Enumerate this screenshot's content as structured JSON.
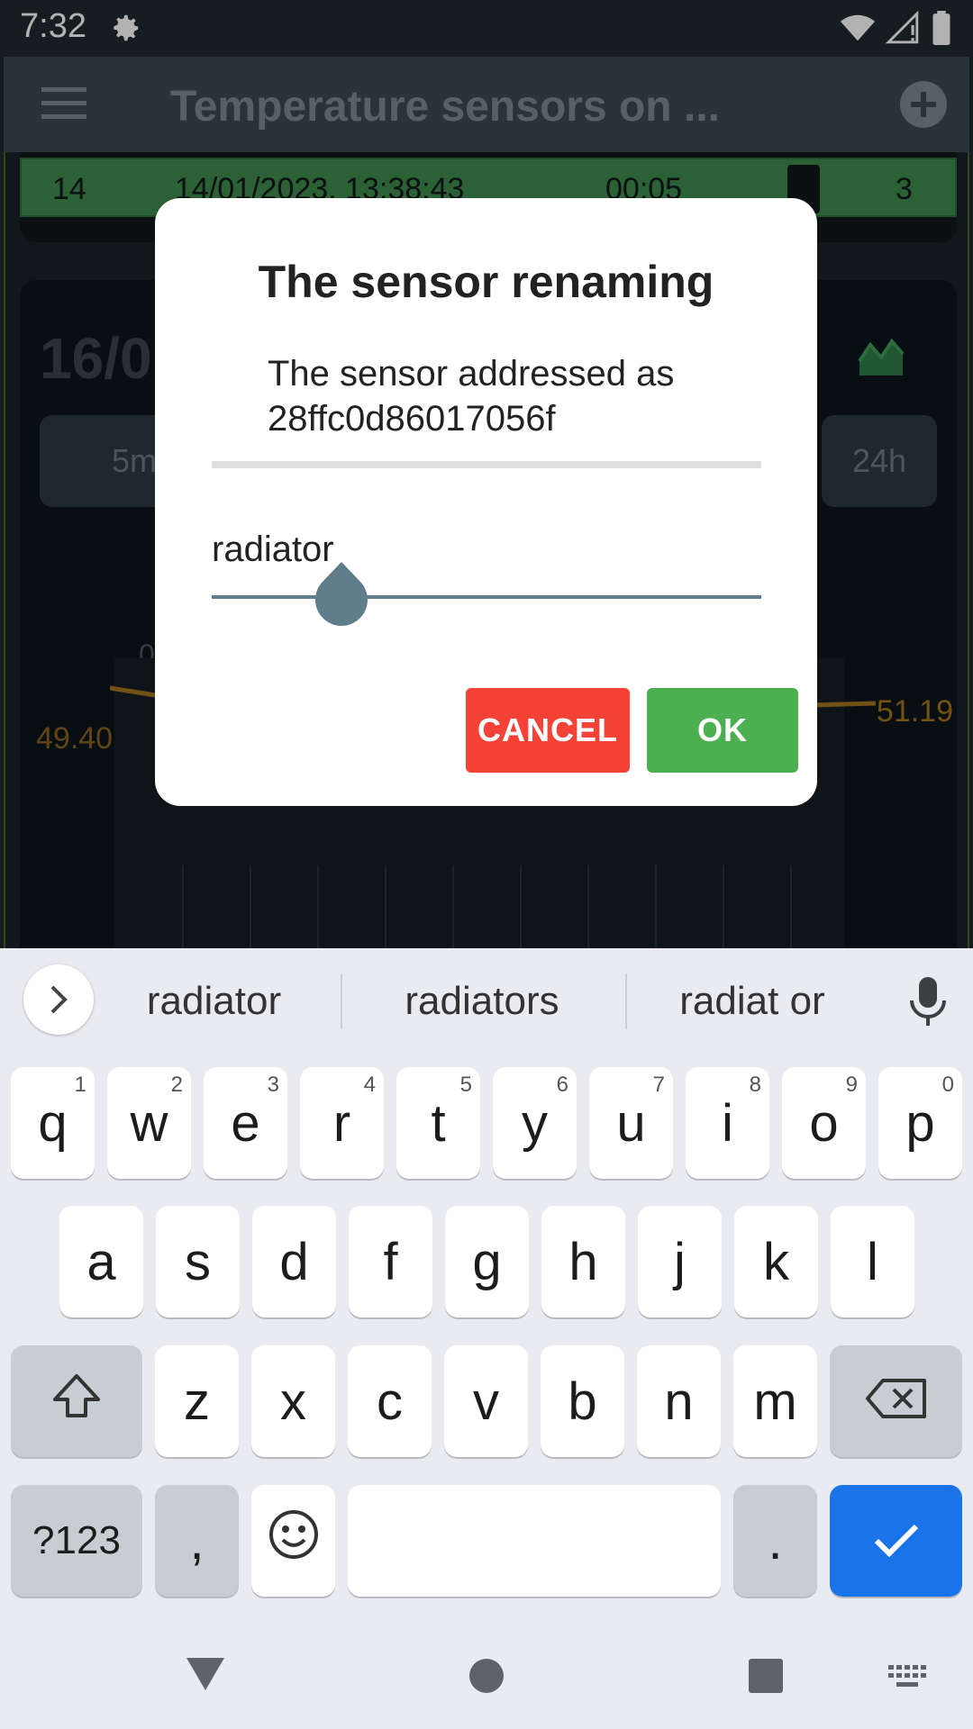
{
  "status_bar": {
    "time": "7:32"
  },
  "app_bar": {
    "title": "Temperature sensors on ..."
  },
  "background": {
    "row": {
      "index": "14",
      "datetime": "14/01/2023, 13:38:43",
      "duration": "00:05",
      "count": "3"
    },
    "date_partial": "16/0",
    "chips": [
      "5m",
      "24h"
    ],
    "tick_partial": "0",
    "value_left": "49.40",
    "value_right": "51.19"
  },
  "dialog": {
    "title": "The sensor renaming",
    "description": "The sensor addressed as 28ffc0d86017056f",
    "input_value": "radiator",
    "cancel_label": "CANCEL",
    "ok_label": "OK"
  },
  "keyboard": {
    "suggestions": [
      "radiator",
      "radiators",
      "radiat or"
    ],
    "rows": [
      [
        {
          "k": "q",
          "h": "1"
        },
        {
          "k": "w",
          "h": "2"
        },
        {
          "k": "e",
          "h": "3"
        },
        {
          "k": "r",
          "h": "4"
        },
        {
          "k": "t",
          "h": "5"
        },
        {
          "k": "y",
          "h": "6"
        },
        {
          "k": "u",
          "h": "7"
        },
        {
          "k": "i",
          "h": "8"
        },
        {
          "k": "o",
          "h": "9"
        },
        {
          "k": "p",
          "h": "0"
        }
      ],
      [
        {
          "k": "a"
        },
        {
          "k": "s"
        },
        {
          "k": "d"
        },
        {
          "k": "f"
        },
        {
          "k": "g"
        },
        {
          "k": "h"
        },
        {
          "k": "j"
        },
        {
          "k": "k"
        },
        {
          "k": "l"
        }
      ],
      [
        {
          "k": "z"
        },
        {
          "k": "x"
        },
        {
          "k": "c"
        },
        {
          "k": "v"
        },
        {
          "k": "b"
        },
        {
          "k": "n"
        },
        {
          "k": "m"
        }
      ]
    ],
    "symbols_label": "?123",
    "comma_label": ",",
    "period_label": "."
  },
  "colors": {
    "accent_ok": "#4caf50",
    "accent_cancel": "#f44336",
    "enter_key": "#1a73e8",
    "slider": "#607d8b"
  }
}
